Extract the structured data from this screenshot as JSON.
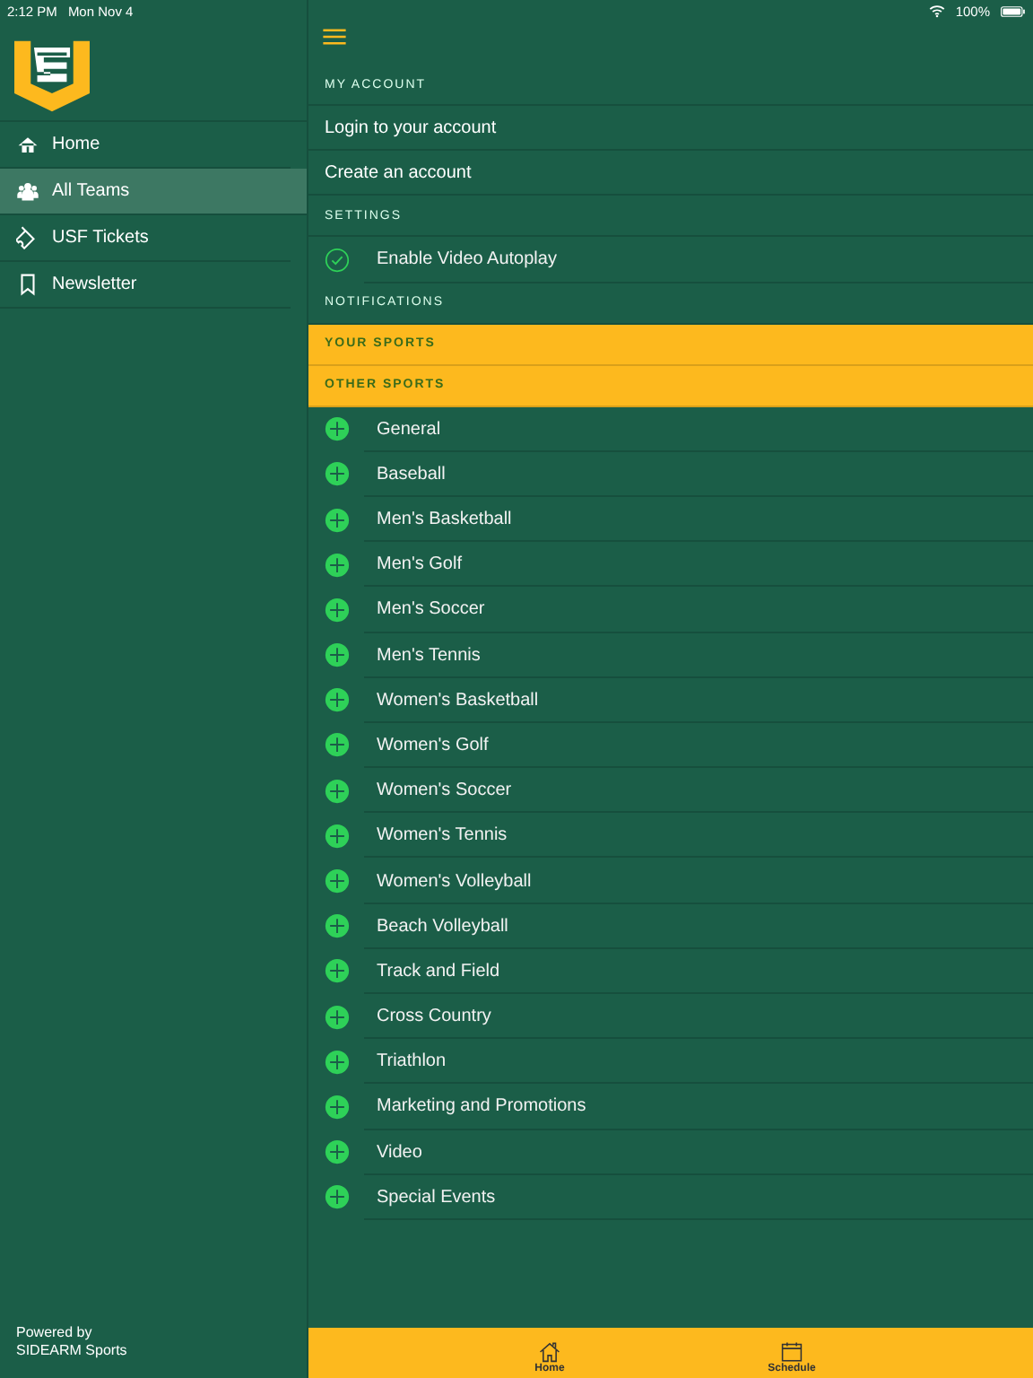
{
  "status_bar": {
    "time": "2:12 PM",
    "date": "Mon Nov 4",
    "battery": "100%"
  },
  "sidebar": {
    "items": [
      {
        "label": "Home",
        "selected": false
      },
      {
        "label": "All Teams",
        "selected": true
      },
      {
        "label": "USF Tickets",
        "selected": false
      },
      {
        "label": "Newsletter",
        "selected": false
      }
    ],
    "footer": [
      "Powered by",
      "SIDEARM Sports"
    ]
  },
  "sections": [
    {
      "title": "MY ACCOUNT",
      "kind": "plain",
      "rows": [
        {
          "kind": "link",
          "label": "Login to your account"
        },
        {
          "kind": "link",
          "label": "Create an account"
        }
      ]
    },
    {
      "title": "SETTINGS",
      "kind": "plain",
      "rows": [
        {
          "kind": "toggle",
          "label": "Enable Video Autoplay",
          "checked": true
        }
      ]
    },
    {
      "title": "NOTIFICATIONS",
      "kind": "plain"
    },
    {
      "title": "YOUR SPORTS",
      "kind": "highlight"
    },
    {
      "title": "OTHER SPORTS",
      "kind": "highlight",
      "rows": [
        {
          "kind": "add",
          "label": "General"
        },
        {
          "kind": "add",
          "label": "Baseball"
        },
        {
          "kind": "add",
          "label": "Men's Basketball"
        },
        {
          "kind": "add",
          "label": "Men's Golf"
        },
        {
          "kind": "add",
          "label": "Men's Soccer"
        },
        {
          "kind": "add",
          "label": "Men's Tennis"
        },
        {
          "kind": "add",
          "label": "Women's Basketball"
        },
        {
          "kind": "add",
          "label": "Women's Golf"
        },
        {
          "kind": "add",
          "label": "Women's Soccer"
        },
        {
          "kind": "add",
          "label": "Women's Tennis"
        },
        {
          "kind": "add",
          "label": "Women's Volleyball"
        },
        {
          "kind": "add",
          "label": "Beach Volleyball"
        },
        {
          "kind": "add",
          "label": "Track and Field"
        },
        {
          "kind": "add",
          "label": "Cross Country"
        },
        {
          "kind": "add",
          "label": "Triathlon"
        },
        {
          "kind": "add",
          "label": "Marketing and Promotions"
        },
        {
          "kind": "add",
          "label": "Video"
        },
        {
          "kind": "add",
          "label": "Special Events"
        }
      ]
    }
  ],
  "tab_bar": [
    {
      "label": "Home"
    },
    {
      "label": "Schedule"
    }
  ]
}
